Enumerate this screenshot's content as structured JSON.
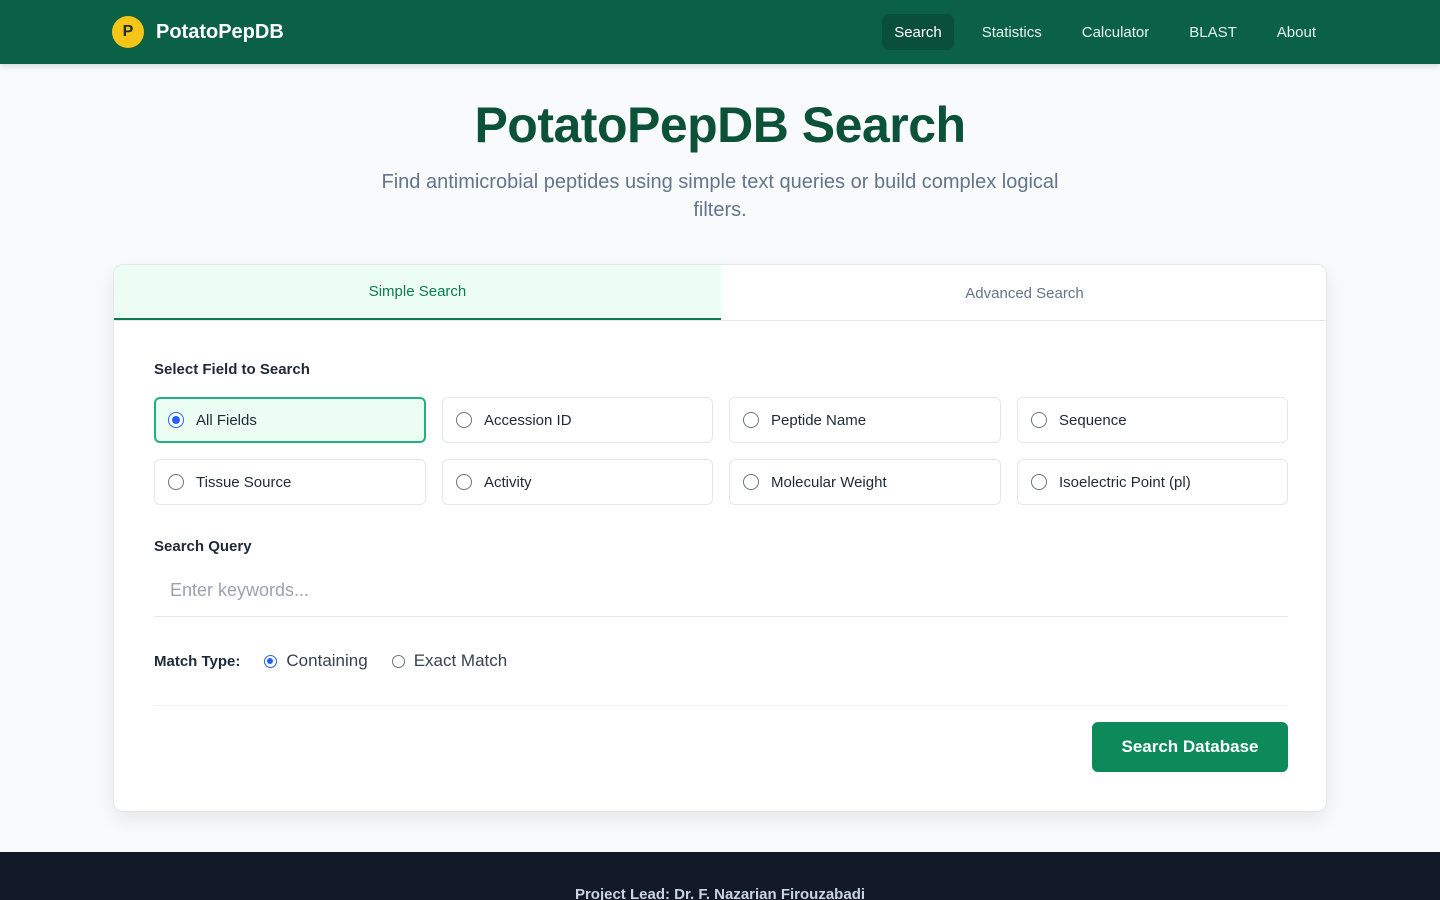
{
  "header": {
    "brand_initial": "P",
    "brand_name": "PotatoPepDB",
    "nav": [
      {
        "label": "Search",
        "active": true
      },
      {
        "label": "Statistics"
      },
      {
        "label": "Calculator"
      },
      {
        "label": "BLAST"
      },
      {
        "label": "About"
      }
    ]
  },
  "hero": {
    "title": "PotatoPepDB Search",
    "subtitle": "Find antimicrobial peptides using simple text queries or build complex logical filters."
  },
  "tabs": [
    {
      "label": "Simple Search",
      "active": true
    },
    {
      "label": "Advanced Search"
    }
  ],
  "form": {
    "field_section_label": "Select Field to Search",
    "fields": [
      {
        "label": "All Fields",
        "selected": true
      },
      {
        "label": "Accession ID"
      },
      {
        "label": "Peptide Name"
      },
      {
        "label": "Sequence"
      },
      {
        "label": "Tissue Source"
      },
      {
        "label": "Activity"
      },
      {
        "label": "Molecular Weight"
      },
      {
        "label": "Isoelectric Point (pl)"
      }
    ],
    "query_label": "Search Query",
    "query_placeholder": "Enter keywords...",
    "query_value": "",
    "match_label": "Match Type:",
    "match_options": [
      {
        "label": "Containing",
        "selected": true
      },
      {
        "label": "Exact Match"
      }
    ],
    "submit_label": "Search Database"
  },
  "footer": {
    "text": "Project Lead: Dr. F. Nazarian Firouzabadi"
  },
  "colors": {
    "header_bg": "#0b6145",
    "accent": "#0c8a5a",
    "title": "#0b5238",
    "footer_bg": "#111827"
  }
}
